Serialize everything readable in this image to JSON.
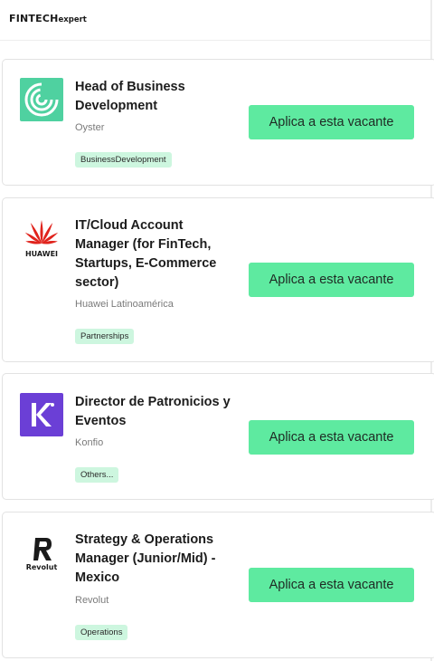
{
  "header": {
    "logo_main": "FINTECH",
    "logo_sub": "expert"
  },
  "jobs": [
    {
      "title": "Head of Business Development",
      "company": "Oyster",
      "tag": "BusinessDevelopment",
      "apply_label": "Aplica a esta vacante",
      "logo_icon": "oyster-logo"
    },
    {
      "title": "IT/Cloud Account Manager (for FinTech, Startups, E-Commerce sector)",
      "company": "Huawei Latinoamérica",
      "tag": "Partnerships",
      "apply_label": "Aplica a esta vacante",
      "logo_icon": "huawei-logo",
      "logo_text": "HUAWEI"
    },
    {
      "title": "Director de Patronicios y Eventos",
      "company": "Konfio",
      "tag": "Others...",
      "apply_label": "Aplica a esta vacante",
      "logo_icon": "konfio-logo"
    },
    {
      "title": "Strategy & Operations Manager (Junior/Mid) - Mexico",
      "company": "Revolut",
      "tag": "Operations",
      "apply_label": "Aplica a esta vacante",
      "logo_icon": "revolut-logo",
      "logo_text": "Revolut"
    }
  ],
  "colors": {
    "accent": "#5eeaa0",
    "tag_bg": "#cdf6df",
    "oyster": "#4fd1a0",
    "huawei": "#e0231c",
    "konfio": "#6b3fd6"
  }
}
